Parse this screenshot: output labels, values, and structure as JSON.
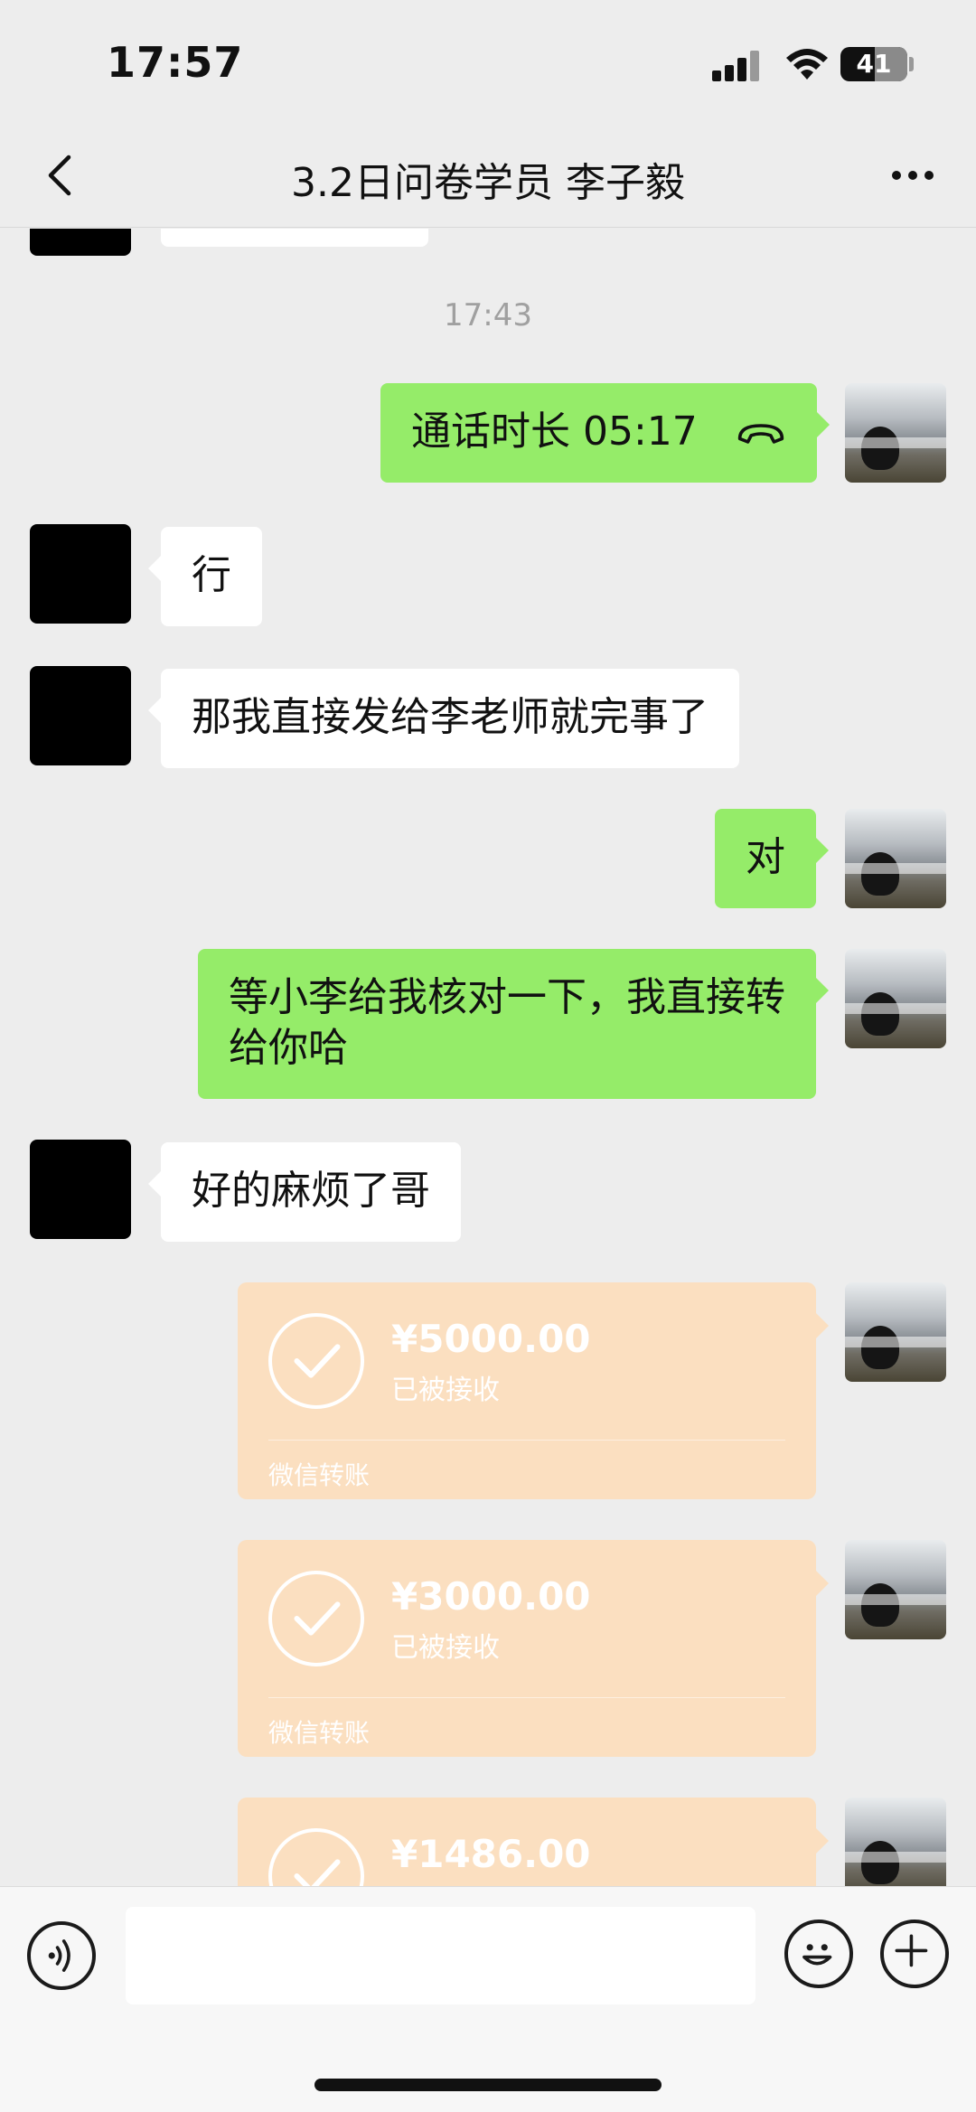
{
  "status_bar": {
    "time": "17:57",
    "battery": "41"
  },
  "header": {
    "title": "3.2日问卷学员 李子毅"
  },
  "chat": {
    "timestamp": "17:43",
    "call": {
      "text": "通话时长 05:17"
    },
    "messages": [
      {
        "from": "other",
        "text": "行"
      },
      {
        "from": "other",
        "text": "那我直接发给李老师就完事了"
      },
      {
        "from": "me",
        "text": "对"
      },
      {
        "from": "me",
        "text": "等小李给我核对一下，我直接转给你哈"
      },
      {
        "from": "other",
        "text": "好的麻烦了哥"
      }
    ],
    "transfers": [
      {
        "amount": "¥5000.00",
        "status": "已被接收",
        "footer": "微信转账"
      },
      {
        "amount": "¥3000.00",
        "status": "已被接收",
        "footer": "微信转账"
      },
      {
        "amount": "¥1486.00",
        "status": "",
        "footer": ""
      }
    ]
  },
  "icons": {
    "back": "chevron-left-icon",
    "more": "more-icon",
    "voice": "voice-icon",
    "emoji": "emoji-icon",
    "plus": "plus-icon",
    "hangup": "hang-up-icon",
    "check": "check-icon"
  },
  "colors": {
    "background": "#ededed",
    "bubble_me": "#95ec69",
    "bubble_other": "#ffffff",
    "transfer": "#fbdfc0"
  }
}
